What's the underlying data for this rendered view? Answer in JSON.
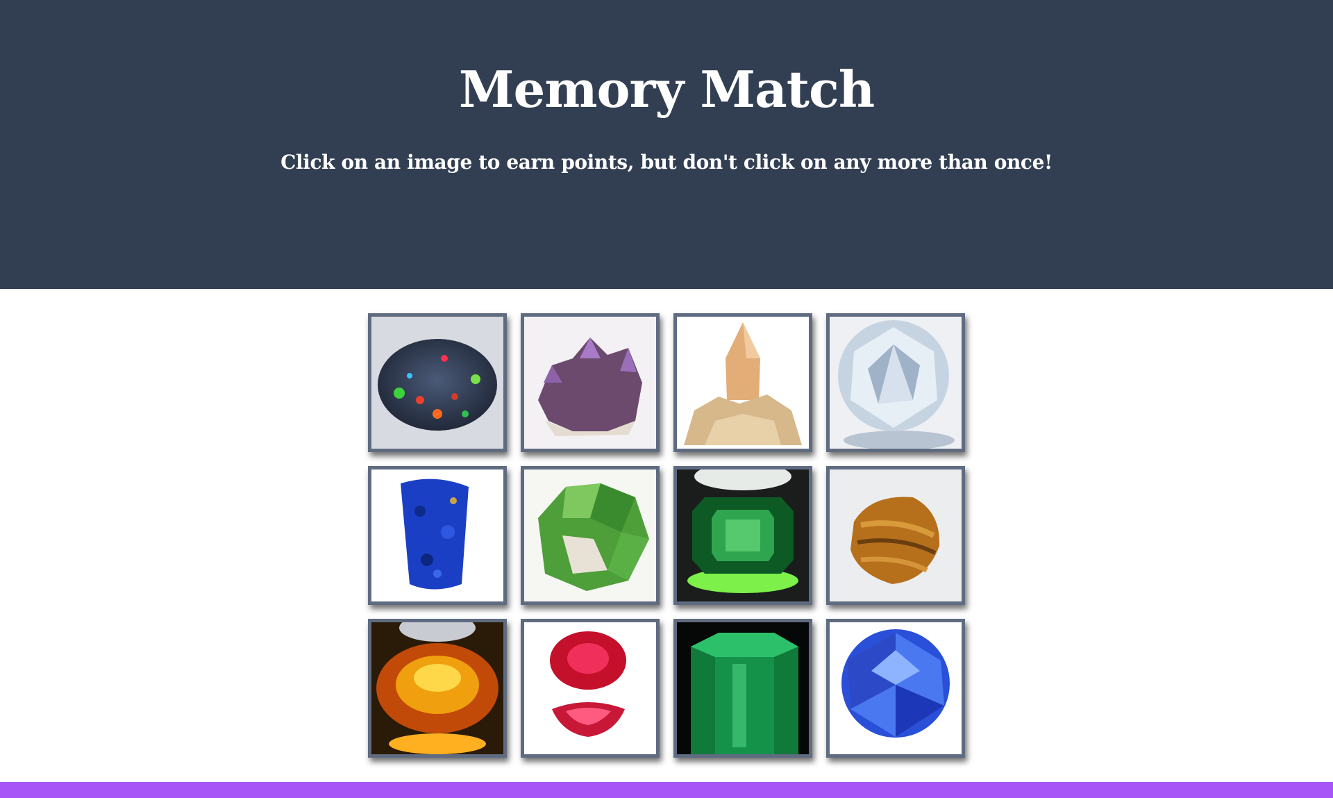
{
  "header": {
    "title": "Memory Match",
    "subtitle": "Click on an image to earn points, but don't click on any more than once!"
  },
  "gems": [
    {
      "name": "opal",
      "icon": "opal-gem-icon"
    },
    {
      "name": "amethyst",
      "icon": "amethyst-crystal-icon"
    },
    {
      "name": "topaz",
      "icon": "topaz-crystal-icon"
    },
    {
      "name": "diamond",
      "icon": "diamond-gem-icon"
    },
    {
      "name": "lapis",
      "icon": "lapis-stone-icon"
    },
    {
      "name": "green garnet",
      "icon": "green-garnet-cluster-icon"
    },
    {
      "name": "emerald cut green",
      "icon": "green-emerald-cut-gem-icon"
    },
    {
      "name": "tigers eye",
      "icon": "tigers-eye-stone-icon"
    },
    {
      "name": "citrine",
      "icon": "orange-oval-gem-icon"
    },
    {
      "name": "ruby",
      "icon": "ruby-gem-icon"
    },
    {
      "name": "emerald",
      "icon": "emerald-crystal-icon"
    },
    {
      "name": "sapphire",
      "icon": "blue-sapphire-gem-icon"
    }
  ],
  "colors": {
    "header_bg": "#323f52",
    "card_border": "#5f6b80",
    "footer_bar": "#a855f7"
  }
}
